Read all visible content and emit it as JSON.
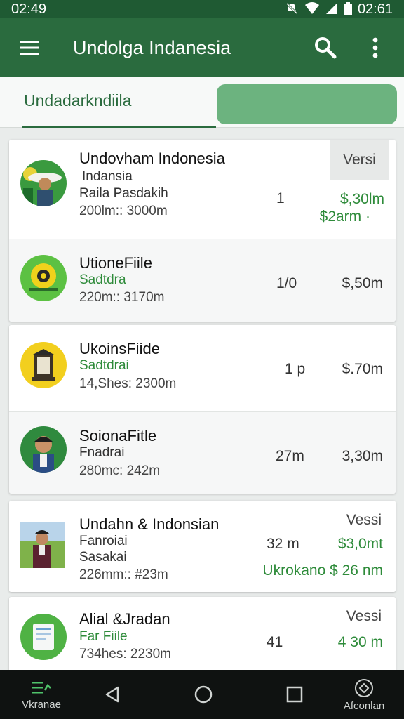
{
  "status_bar": {
    "time_left": "02:49",
    "time_right": "02:61"
  },
  "app_bar": {
    "title": "Undolga Indanesia",
    "menu_icon": "hamburger-menu-icon",
    "search_icon": "search-icon",
    "overflow_icon": "more-vert-icon"
  },
  "tabs": {
    "active_label": "Undadarkndiila"
  },
  "items": [
    {
      "name": "Undovham Indonesia",
      "line2": "Indansia",
      "line3": "Raila Pasdakih",
      "meta": "200lm:: 3000m",
      "mid": "1",
      "price": "$,30lm",
      "price2": "$2arm ·",
      "badge": "Versi"
    },
    {
      "name": "UtioneFiile",
      "line2": "Sadtdra",
      "meta": "220m:: 3170m",
      "mid": "1/0",
      "price": "$,50m"
    },
    {
      "name": "UkoinsFiide",
      "line2": "Sadtdrai",
      "meta": "14,Shes: 2300m",
      "mid": "1 p",
      "price": "$.70m"
    },
    {
      "name": "SoionaFitle",
      "line2": "Fnadrai",
      "meta": "280mc: 242m",
      "mid": "27m",
      "price": "3,30m"
    },
    {
      "name": "Undahn & Indonsian",
      "line2": "Fanroiai",
      "line3": "Sasakai",
      "meta": "226mm:: #23m",
      "mid": "32 m",
      "price": "$3,0mt",
      "vtag": "Vessi",
      "footer": "Ukrokano $ 26 nm"
    },
    {
      "name": "Alial &Jradan",
      "line2": "Far Fiile",
      "meta": "734hes: 2230m",
      "mid": "41",
      "price": "4 30 m",
      "vtag": "Vessi"
    }
  ],
  "nav": {
    "left_label": "Vkranae",
    "right_label": "Afconlan"
  },
  "colors": {
    "primary": "#2a6b3e",
    "status_bar": "#1f5a33",
    "accent_green": "#2e8b3a",
    "tab_pill": "#6cb37f"
  }
}
